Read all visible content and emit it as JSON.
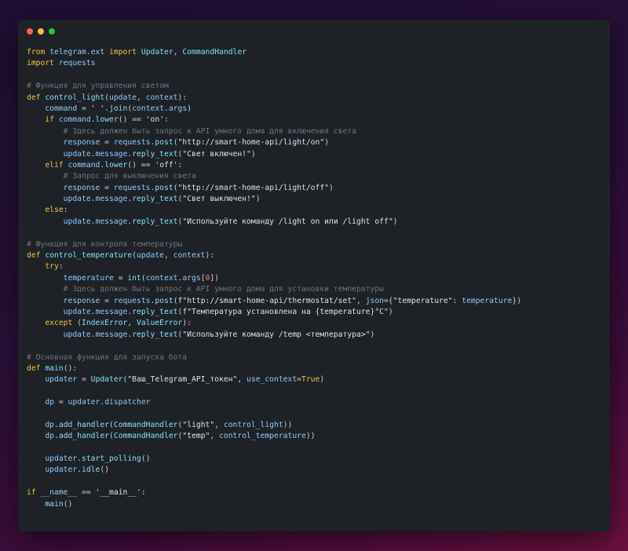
{
  "window": {
    "controls": [
      {
        "name": "close",
        "color": "#ff5f57"
      },
      {
        "name": "minimize",
        "color": "#febc2e"
      },
      {
        "name": "maximize",
        "color": "#28c840"
      }
    ]
  },
  "colors": {
    "keyword": "#f5c542",
    "function": "#86e0ff",
    "identifier": "#8ecbff",
    "string": "#d9e6f2",
    "number": "#ff7b72",
    "comment": "#6e7681",
    "plain": "#c9d1d9"
  },
  "code_lines": [
    [
      [
        "k",
        "from"
      ],
      [
        "p",
        " "
      ],
      [
        "i",
        "telegram"
      ],
      [
        "p",
        "."
      ],
      [
        "i",
        "ext"
      ],
      [
        "p",
        " "
      ],
      [
        "k",
        "import"
      ],
      [
        "p",
        " "
      ],
      [
        "f",
        "Updater"
      ],
      [
        "p",
        ", "
      ],
      [
        "f",
        "CommandHandler"
      ]
    ],
    [
      [
        "k",
        "import"
      ],
      [
        "p",
        " "
      ],
      [
        "i",
        "requests"
      ]
    ],
    [],
    [
      [
        "c",
        "# Функция для управления светом"
      ]
    ],
    [
      [
        "k",
        "def"
      ],
      [
        "p",
        " "
      ],
      [
        "f",
        "control_light"
      ],
      [
        "p",
        "("
      ],
      [
        "i",
        "update"
      ],
      [
        "p",
        ", "
      ],
      [
        "i",
        "context"
      ],
      [
        "p",
        "):"
      ]
    ],
    [
      [
        "p",
        "    "
      ],
      [
        "i",
        "command"
      ],
      [
        "p",
        " = "
      ],
      [
        "s",
        "' '"
      ],
      [
        "p",
        "."
      ],
      [
        "f",
        "join"
      ],
      [
        "p",
        "("
      ],
      [
        "i",
        "context"
      ],
      [
        "p",
        "."
      ],
      [
        "i",
        "args"
      ],
      [
        "p",
        ")"
      ]
    ],
    [
      [
        "p",
        "    "
      ],
      [
        "k",
        "if"
      ],
      [
        "p",
        " "
      ],
      [
        "i",
        "command"
      ],
      [
        "p",
        "."
      ],
      [
        "f",
        "lower"
      ],
      [
        "p",
        "() == "
      ],
      [
        "s",
        "'on'"
      ],
      [
        "p",
        ":"
      ]
    ],
    [
      [
        "p",
        "        "
      ],
      [
        "c",
        "# Здесь должен быть запрос к API умного дома для включения света"
      ]
    ],
    [
      [
        "p",
        "        "
      ],
      [
        "i",
        "response"
      ],
      [
        "p",
        " = "
      ],
      [
        "i",
        "requests"
      ],
      [
        "p",
        "."
      ],
      [
        "f",
        "post"
      ],
      [
        "p",
        "("
      ],
      [
        "s",
        "\"http://smart-home-api/light/on\""
      ],
      [
        "p",
        ")"
      ]
    ],
    [
      [
        "p",
        "        "
      ],
      [
        "i",
        "update"
      ],
      [
        "p",
        "."
      ],
      [
        "i",
        "message"
      ],
      [
        "p",
        "."
      ],
      [
        "f",
        "reply_text"
      ],
      [
        "p",
        "("
      ],
      [
        "s",
        "\"Свет включен!\""
      ],
      [
        "p",
        ")"
      ]
    ],
    [
      [
        "p",
        "    "
      ],
      [
        "k",
        "elif"
      ],
      [
        "p",
        " "
      ],
      [
        "i",
        "command"
      ],
      [
        "p",
        "."
      ],
      [
        "f",
        "lower"
      ],
      [
        "p",
        "() == "
      ],
      [
        "s",
        "'off'"
      ],
      [
        "p",
        ":"
      ]
    ],
    [
      [
        "p",
        "        "
      ],
      [
        "c",
        "# Запрос для выключения света"
      ]
    ],
    [
      [
        "p",
        "        "
      ],
      [
        "i",
        "response"
      ],
      [
        "p",
        " = "
      ],
      [
        "i",
        "requests"
      ],
      [
        "p",
        "."
      ],
      [
        "f",
        "post"
      ],
      [
        "p",
        "("
      ],
      [
        "s",
        "\"http://smart-home-api/light/off\""
      ],
      [
        "p",
        ")"
      ]
    ],
    [
      [
        "p",
        "        "
      ],
      [
        "i",
        "update"
      ],
      [
        "p",
        "."
      ],
      [
        "i",
        "message"
      ],
      [
        "p",
        "."
      ],
      [
        "f",
        "reply_text"
      ],
      [
        "p",
        "("
      ],
      [
        "s",
        "\"Свет выключен!\""
      ],
      [
        "p",
        ")"
      ]
    ],
    [
      [
        "p",
        "    "
      ],
      [
        "k",
        "else"
      ],
      [
        "p",
        ":"
      ]
    ],
    [
      [
        "p",
        "        "
      ],
      [
        "i",
        "update"
      ],
      [
        "p",
        "."
      ],
      [
        "i",
        "message"
      ],
      [
        "p",
        "."
      ],
      [
        "f",
        "reply_text"
      ],
      [
        "p",
        "("
      ],
      [
        "s",
        "\"Используйте команду /light on или /light off\""
      ],
      [
        "p",
        ")"
      ]
    ],
    [],
    [
      [
        "c",
        "# Функция для контроля температуры"
      ]
    ],
    [
      [
        "k",
        "def"
      ],
      [
        "p",
        " "
      ],
      [
        "f",
        "control_temperature"
      ],
      [
        "p",
        "("
      ],
      [
        "i",
        "update"
      ],
      [
        "p",
        ", "
      ],
      [
        "i",
        "context"
      ],
      [
        "p",
        "):"
      ]
    ],
    [
      [
        "p",
        "    "
      ],
      [
        "k",
        "try"
      ],
      [
        "p",
        ":"
      ]
    ],
    [
      [
        "p",
        "        "
      ],
      [
        "i",
        "temperature"
      ],
      [
        "p",
        " = "
      ],
      [
        "f",
        "int"
      ],
      [
        "p",
        "("
      ],
      [
        "i",
        "context"
      ],
      [
        "p",
        "."
      ],
      [
        "i",
        "args"
      ],
      [
        "p",
        "["
      ],
      [
        "n",
        "0"
      ],
      [
        "p",
        "])"
      ]
    ],
    [
      [
        "p",
        "        "
      ],
      [
        "c",
        "# Здесь должен быть запрос к API умного дома для установки температуры"
      ]
    ],
    [
      [
        "p",
        "        "
      ],
      [
        "i",
        "response"
      ],
      [
        "p",
        " = "
      ],
      [
        "i",
        "requests"
      ],
      [
        "p",
        "."
      ],
      [
        "f",
        "post"
      ],
      [
        "p",
        "("
      ],
      [
        "s",
        "f\"http://smart-home-api/thermostat/set\""
      ],
      [
        "p",
        ", "
      ],
      [
        "i",
        "json"
      ],
      [
        "p",
        "={"
      ],
      [
        "s",
        "\"temperature\""
      ],
      [
        "p",
        ": "
      ],
      [
        "i",
        "temperature"
      ],
      [
        "p",
        "})"
      ]
    ],
    [
      [
        "p",
        "        "
      ],
      [
        "i",
        "update"
      ],
      [
        "p",
        "."
      ],
      [
        "i",
        "message"
      ],
      [
        "p",
        "."
      ],
      [
        "f",
        "reply_text"
      ],
      [
        "p",
        "("
      ],
      [
        "s",
        "f\"Температура установлена на {temperature}°C\""
      ],
      [
        "p",
        ")"
      ]
    ],
    [
      [
        "p",
        "    "
      ],
      [
        "k",
        "except"
      ],
      [
        "p",
        " ("
      ],
      [
        "f",
        "IndexError"
      ],
      [
        "p",
        ", "
      ],
      [
        "f",
        "ValueError"
      ],
      [
        "p",
        "):"
      ]
    ],
    [
      [
        "p",
        "        "
      ],
      [
        "i",
        "update"
      ],
      [
        "p",
        "."
      ],
      [
        "i",
        "message"
      ],
      [
        "p",
        "."
      ],
      [
        "f",
        "reply_text"
      ],
      [
        "p",
        "("
      ],
      [
        "s",
        "\"Используйте команду /temp <температура>\""
      ],
      [
        "p",
        ")"
      ]
    ],
    [],
    [
      [
        "c",
        "# Основная функция для запуска бота"
      ]
    ],
    [
      [
        "k",
        "def"
      ],
      [
        "p",
        " "
      ],
      [
        "f",
        "main"
      ],
      [
        "p",
        "():"
      ]
    ],
    [
      [
        "p",
        "    "
      ],
      [
        "i",
        "updater"
      ],
      [
        "p",
        " = "
      ],
      [
        "f",
        "Updater"
      ],
      [
        "p",
        "("
      ],
      [
        "s",
        "\"Ваш_Telegram_API_токен\""
      ],
      [
        "p",
        ", "
      ],
      [
        "i",
        "use_context"
      ],
      [
        "p",
        "="
      ],
      [
        "k",
        "True"
      ],
      [
        "p",
        ")"
      ]
    ],
    [],
    [
      [
        "p",
        "    "
      ],
      [
        "i",
        "dp"
      ],
      [
        "p",
        " = "
      ],
      [
        "i",
        "updater"
      ],
      [
        "p",
        "."
      ],
      [
        "i",
        "dispatcher"
      ]
    ],
    [],
    [
      [
        "p",
        "    "
      ],
      [
        "i",
        "dp"
      ],
      [
        "p",
        "."
      ],
      [
        "f",
        "add_handler"
      ],
      [
        "p",
        "("
      ],
      [
        "f",
        "CommandHandler"
      ],
      [
        "p",
        "("
      ],
      [
        "s",
        "\"light\""
      ],
      [
        "p",
        ", "
      ],
      [
        "i",
        "control_light"
      ],
      [
        "p",
        "))"
      ]
    ],
    [
      [
        "p",
        "    "
      ],
      [
        "i",
        "dp"
      ],
      [
        "p",
        "."
      ],
      [
        "f",
        "add_handler"
      ],
      [
        "p",
        "("
      ],
      [
        "f",
        "CommandHandler"
      ],
      [
        "p",
        "("
      ],
      [
        "s",
        "\"temp\""
      ],
      [
        "p",
        ", "
      ],
      [
        "i",
        "control_temperature"
      ],
      [
        "p",
        "))"
      ]
    ],
    [],
    [
      [
        "p",
        "    "
      ],
      [
        "i",
        "updater"
      ],
      [
        "p",
        "."
      ],
      [
        "f",
        "start_polling"
      ],
      [
        "p",
        "()"
      ]
    ],
    [
      [
        "p",
        "    "
      ],
      [
        "i",
        "updater"
      ],
      [
        "p",
        "."
      ],
      [
        "f",
        "idle"
      ],
      [
        "p",
        "()"
      ]
    ],
    [],
    [
      [
        "k",
        "if"
      ],
      [
        "p",
        " "
      ],
      [
        "i",
        "__name__"
      ],
      [
        "p",
        " == "
      ],
      [
        "s",
        "'__main__'"
      ],
      [
        "p",
        ":"
      ]
    ],
    [
      [
        "p",
        "    "
      ],
      [
        "f",
        "main"
      ],
      [
        "p",
        "()"
      ]
    ]
  ]
}
